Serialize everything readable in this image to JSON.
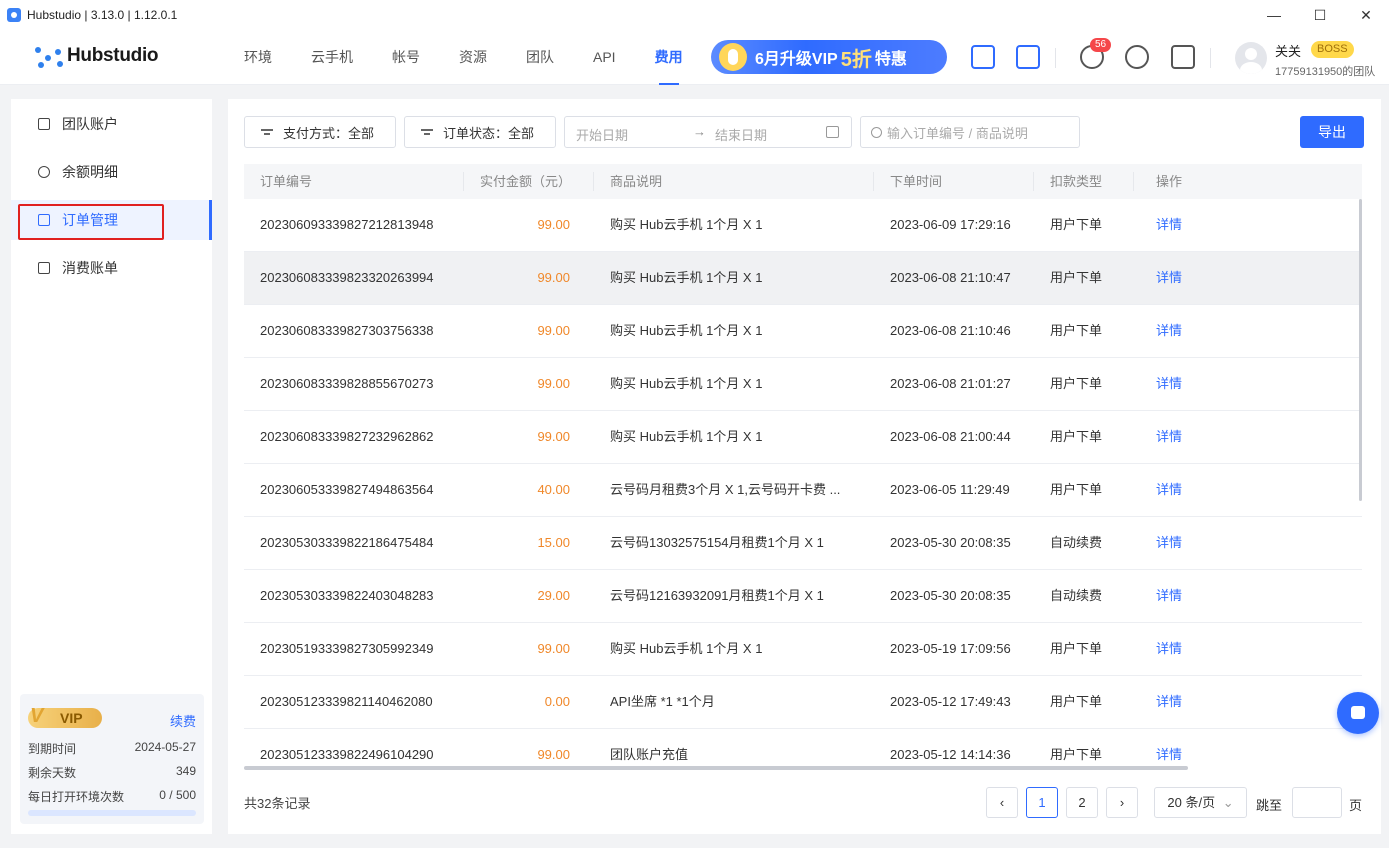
{
  "window": {
    "title": "Hubstudio | 3.13.0 | 1.12.0.1",
    "minimize": "—",
    "maximize": "☐",
    "close": "✕"
  },
  "header": {
    "logo_text": "Hubstudio",
    "nav": [
      "环境",
      "云手机",
      "帐号",
      "资源",
      "团队",
      "API",
      "费用"
    ],
    "active_nav": "费用",
    "promo": {
      "prefix": "6月升级VIP",
      "highlight": "5折",
      "suffix": "特惠"
    },
    "notification_count": "56",
    "user": {
      "name": "关关",
      "role": "BOSS",
      "team": "17759131950的团队"
    },
    "icons": [
      "scan-device-icon",
      "monitor-icon",
      "bell-icon",
      "sync-download-icon",
      "clock-doc-icon"
    ]
  },
  "sidebar": {
    "items": [
      {
        "label": "团队账户",
        "icon": "wallet-icon"
      },
      {
        "label": "余额明细",
        "icon": "yen-icon"
      },
      {
        "label": "订单管理",
        "icon": "clipboard-icon"
      },
      {
        "label": "消费账单",
        "icon": "bill-icon"
      }
    ],
    "active_item": "订单管理",
    "vip": {
      "badge": "VIP",
      "renew": "续费",
      "expire_label": "到期时间",
      "expire_value": "2024-05-27",
      "days_label": "剩余天数",
      "days_value": "349",
      "daily_label": "每日打开环境次数",
      "daily_value": "0 / 500",
      "daily_used_fraction": 0
    }
  },
  "filters": {
    "payment": "支付方式：全部",
    "status": "订单状态：全部",
    "start_placeholder": "开始日期",
    "arrow": "→",
    "end_placeholder": "结束日期",
    "search_placeholder": "输入订单编号 / 商品说明",
    "export": "导出"
  },
  "table": {
    "columns": [
      "订单编号",
      "实付金额（元）",
      "商品说明",
      "下单时间",
      "扣款类型",
      "操作"
    ],
    "rows": [
      {
        "id": "20230609333982721281394­8",
        "amount": "99.00",
        "desc": "购买 Hub云手机 1个月 X 1",
        "time": "2023-06-09 17:29:16",
        "type": "用户下单",
        "action": "详情"
      },
      {
        "id": "202306083339823320263994",
        "amount": "99.00",
        "desc": "购买 Hub云手机 1个月 X 1",
        "time": "2023-06-08 21:10:47",
        "type": "用户下单",
        "action": "详情"
      },
      {
        "id": "202306083339827303756338",
        "amount": "99.00",
        "desc": "购买 Hub云手机 1个月 X 1",
        "time": "2023-06-08 21:10:46",
        "type": "用户下单",
        "action": "详情"
      },
      {
        "id": "202306083339828855670273",
        "amount": "99.00",
        "desc": "购买 Hub云手机 1个月 X 1",
        "time": "2023-06-08 21:01:27",
        "type": "用户下单",
        "action": "详情"
      },
      {
        "id": "202306083339827232962862",
        "amount": "99.00",
        "desc": "购买 Hub云手机 1个月 X 1",
        "time": "2023-06-08 21:00:44",
        "type": "用户下单",
        "action": "详情"
      },
      {
        "id": "202306053339827494863564",
        "amount": "40.00",
        "desc": "云号码月租费3个月 X 1,云号码开卡费 ...",
        "time": "2023-06-05 11:29:49",
        "type": "用户下单",
        "action": "详情"
      },
      {
        "id": "202305303339822186475484",
        "amount": "15.00",
        "desc": "云号码13032575154月租费1个月 X 1",
        "time": "2023-05-30 20:08:35",
        "type": "自动续费",
        "action": "详情"
      },
      {
        "id": "202305303339822403048283",
        "amount": "29.00",
        "desc": "云号码12163932091月租费1个月 X 1",
        "time": "2023-05-30 20:08:35",
        "type": "自动续费",
        "action": "详情"
      },
      {
        "id": "202305193339827305992349",
        "amount": "99.00",
        "desc": "购买 Hub云手机 1个月 X 1",
        "time": "2023-05-19 17:09:56",
        "type": "用户下单",
        "action": "详情"
      },
      {
        "id": "202305123339821140462080",
        "amount": "0.00",
        "desc": "API坐席 *1 *1个月",
        "time": "2023-05-12 17:49:43",
        "type": "用户下单",
        "action": "详情"
      },
      {
        "id": "202305123339822496104290",
        "amount": "99.00",
        "desc": "团队账户充值",
        "time": "2023-05-12 14:14:36",
        "type": "用户下单",
        "action": "详情"
      }
    ]
  },
  "pagination": {
    "total": "共32条记录",
    "prev": "‹",
    "pages": [
      "1",
      "2"
    ],
    "current": "1",
    "next": "›",
    "page_size": "20 条/页",
    "jump_label": "跳至",
    "page_suffix": "页"
  },
  "colors": {
    "accent": "#2f6bff",
    "amount": "#f0882a",
    "highlight_border": "#e02020"
  }
}
